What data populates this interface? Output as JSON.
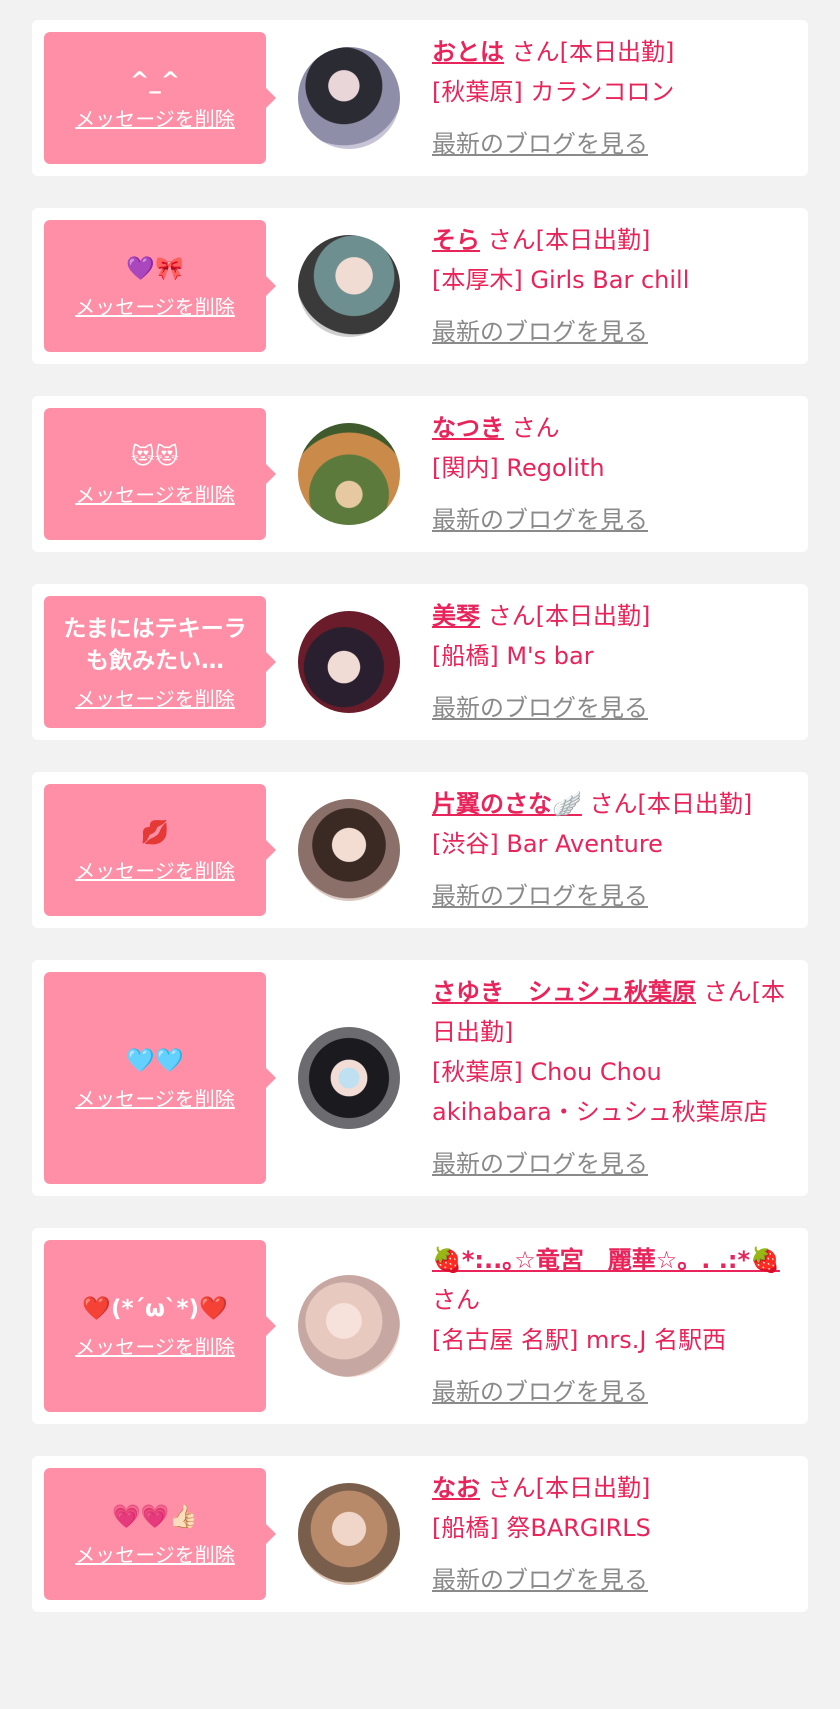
{
  "delete_label": "メッセージを削除",
  "blog_label": "最新のブログを見る",
  "colors": {
    "accent": "#e8245a",
    "bubble": "#ff8fa6",
    "background": "#f2f2f2",
    "link_gray": "#8a8a8a"
  },
  "cards": [
    {
      "message": "^_^",
      "name": "おとは",
      "suffix": "さん[本日出勤]",
      "shop": "[秋葉原] カランコロン"
    },
    {
      "message": "💜🎀",
      "name": "そら",
      "suffix": "さん[本日出勤]",
      "shop": "[本厚木] Girls Bar chill"
    },
    {
      "message": "😻😻",
      "name": "なつき",
      "suffix": "さん",
      "shop": "[関内] Regolith"
    },
    {
      "message": "たまにはテキーラも飲みたい…",
      "name": "美琴",
      "suffix": "さん[本日出勤]",
      "shop": "[船橋] M's bar"
    },
    {
      "message": "💋",
      "name": "片翼のさな🪽",
      "suffix": "さん[本日出勤]",
      "shop": "[渋谷] Bar Aventure"
    },
    {
      "message": "🩵🩵",
      "name": "さゆき　シュシュ秋葉原",
      "suffix": "さん[本日出勤]",
      "shop": "[秋葉原] Chou Chou akihabara・シュシュ秋葉原店"
    },
    {
      "message": "❤️(*´ω`*)❤️",
      "name": "🍓*:..｡☆竜宮　麗華☆。. .:*🍓",
      "suffix": "さん",
      "shop": "[名古屋 名駅] mrs.J 名駅西"
    },
    {
      "message": "💗💗👍🏻",
      "name": "なお",
      "suffix": "さん[本日出勤]",
      "shop": "[船橋] 祭BARGIRLS"
    }
  ]
}
